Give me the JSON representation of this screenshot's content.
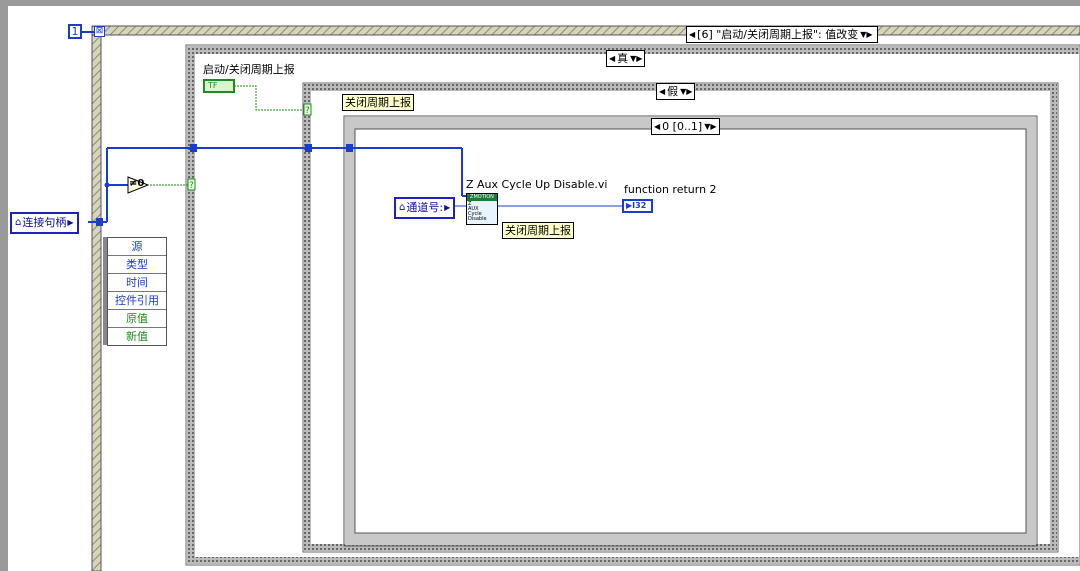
{
  "diagram": {
    "frame_number": "1",
    "event_case_selector": "[6] \"启动/关闭周期上报\": 值改变",
    "case_true_selector": "真",
    "case_false_selector": "假",
    "sequence_selector": "0 [0..1]",
    "boolean_control_label": "启动/关闭周期上报",
    "boolean_control_text": "TF",
    "connection_handle_label": "连接句柄",
    "channel_label": "通道号:",
    "not_equal_zero_text": "≠0",
    "close_label_top": "关闭周期上报",
    "close_label_sub": "关闭周期上报",
    "subvi_title": "Z Aux Cycle Up Disable.vi",
    "subvi_icon_text": [
      "ZMOTION",
      "Z",
      "AUX",
      "Cycle",
      "Disable"
    ],
    "return_label": "function return 2",
    "return_indicator": "I32",
    "event_fields": [
      "源",
      "类型",
      "时间",
      "控件引用",
      "原值",
      "新值"
    ],
    "colors": {
      "wire_blue": "#1a3ccf",
      "wire_green": "#1e8c1e",
      "frame_gray": "#9a9a9a",
      "label_yellow": "#ffffcc"
    }
  }
}
